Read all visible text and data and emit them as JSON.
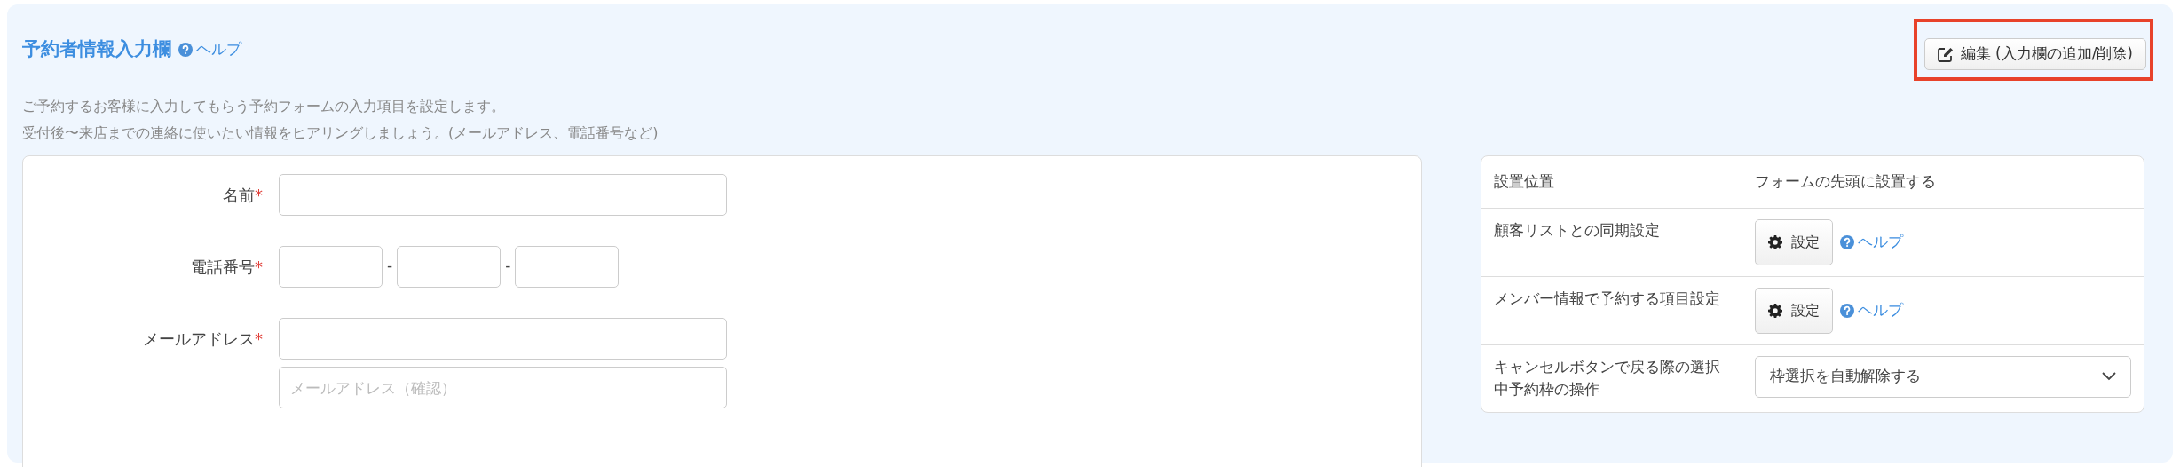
{
  "section": {
    "title": "予約者情報入力欄",
    "help_link": "ヘルプ",
    "description": [
      "ご予約するお客様に入力してもらう予約フォームの入力項目を設定します。",
      "受付後〜来店までの連絡に使いたい情報をヒアリングしましょう。(メールアドレス、電話番号など)"
    ],
    "edit_button": {
      "label": "編集 (入力欄の追加/削除)",
      "highlighted": true
    }
  },
  "form_fields": [
    {
      "kind": "text",
      "label": "名前",
      "required_mark": "*"
    },
    {
      "kind": "phone",
      "label": "電話番号",
      "required_mark": "*",
      "separators": [
        "-",
        "-"
      ]
    },
    {
      "kind": "email",
      "label": "メールアドレス",
      "required_mark": "*",
      "confirm_placeholder": "メールアドレス（確認）"
    }
  ],
  "settings": [
    {
      "kind": "text",
      "label": "設置位置",
      "value": "フォームの先頭に設置する"
    },
    {
      "kind": "button",
      "label": "顧客リストとの同期設定",
      "button": "設定",
      "help_link": "ヘルプ"
    },
    {
      "kind": "button",
      "label": "メンバー情報で予約する項目設定",
      "button": "設定",
      "help_link": "ヘルプ"
    },
    {
      "kind": "select",
      "label": "キャンセルボタンで戻る際の選択中予約枠の操作",
      "value": "枠選択を自動解除する"
    }
  ]
}
